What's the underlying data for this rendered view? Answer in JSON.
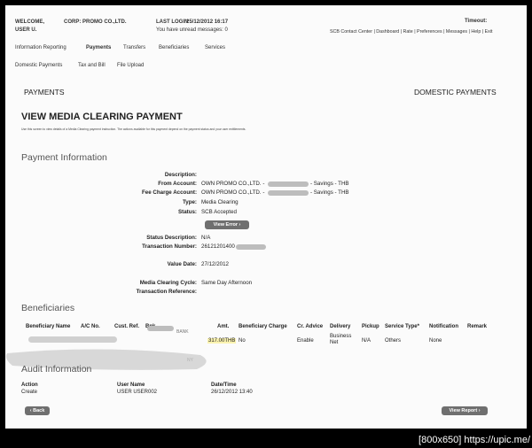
{
  "header": {
    "welcome": "WELCOME,",
    "company": "CORP: PROMO CO.,LTD.",
    "user": "USER U.",
    "last_login_label": "LAST LOGIN",
    "last_login_value": "25/12/2012 16:17",
    "unread": "You have unread messages: 0",
    "timeout": "Timeout:",
    "top_links": "SCB Contact Center | Dashboard | Rate | Preferences | Messages | Help | Exit"
  },
  "nav": {
    "main": [
      "Information Reporting",
      "Payments",
      "Transfers",
      "Beneficiaries",
      "Services"
    ],
    "sub": [
      "Domestic Payments",
      "Tax and Bill",
      "File Upload"
    ]
  },
  "page": {
    "section_left": "PAYMENTS",
    "section_right": "DOMESTIC PAYMENTS",
    "title": "VIEW MEDIA CLEARING PAYMENT",
    "instructions": "Use this screen to view details of a Media Clearing payment instruction. The actions available for this payment depend on the payment status and your user entitlements."
  },
  "payment_info": {
    "heading": "Payment Information",
    "description_label": "Description:",
    "from_label": "From Account:",
    "from_prefix": "OWN PROMO CO.,LTD. -",
    "from_suffix": "- Savings - THB",
    "fee_label": "Fee Charge Account:",
    "fee_prefix": "OWN PROMO CO.,LTD. -",
    "fee_suffix": "- Savings - THB",
    "type_label": "Type:",
    "type_value": "Media Clearing",
    "status_label": "Status:",
    "status_value": "SCB Accepted",
    "view_error": "View Error",
    "status_desc_label": "Status Description:",
    "status_desc_value": "N/A",
    "txn_no_label": "Transaction Number:",
    "txn_no_value": "26121201400",
    "value_date_label": "Value Date:",
    "value_date_value": "27/12/2012",
    "cycle_label": "Media Clearing Cycle:",
    "cycle_value": "Same Day Afternoon",
    "txn_ref_label": "Transaction Reference:"
  },
  "beneficiaries": {
    "heading": "Beneficiaries",
    "columns": [
      "Beneficiary Name",
      "A/C No.",
      "Cust. Ref.",
      "Bnk.",
      "Amt.",
      "Beneficiary Charge",
      "Cr. Advice",
      "Delivery",
      "Pickup",
      "Service Type*",
      "Notification",
      "Remark"
    ],
    "row": {
      "bank_frag_1": "BANK",
      "bank_frag_2": "NY",
      "amount": "317.00THB",
      "beneficiary_charge": "No",
      "cr_advice": "Enable",
      "delivery": "Business Net",
      "pickup": "N/A",
      "service_type": "Others",
      "notification": "None"
    }
  },
  "audit": {
    "heading": "Audit Information",
    "action_label": "Action",
    "action_value": "Create",
    "user_label": "User Name",
    "user_value": "USER USER002",
    "dt_label": "Date/Time",
    "dt_value": "26/12/2012 13:40"
  },
  "buttons": {
    "back": "Back",
    "view_report": "View Report"
  },
  "watermark": "[800x650] https://upic.me/",
  "colors": {
    "highlight": "#fbf3b0",
    "button": "#6f6f6f",
    "frame": "#000000"
  }
}
